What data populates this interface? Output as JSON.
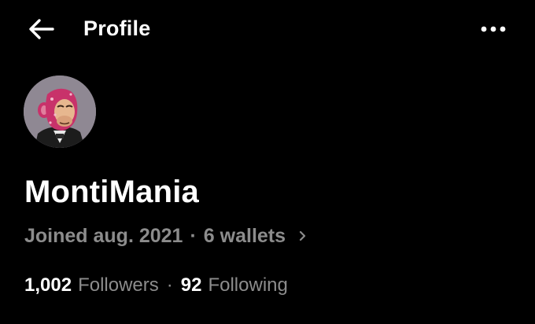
{
  "header": {
    "back_icon": "arrow-left-icon",
    "title": "Profile",
    "more_icon": "more-horizontal-icon"
  },
  "profile": {
    "avatar": "ape-nft-avatar",
    "name": "MontiMania",
    "joined": "Joined aug. 2021",
    "separator": "·",
    "wallets": "6 wallets",
    "wallets_icon": "chevron-right-icon"
  },
  "stats": {
    "followers_count": "1,002",
    "followers_label": "Followers",
    "separator": "·",
    "following_count": "92",
    "following_label": "Following"
  },
  "colors": {
    "background": "#000000",
    "text_primary": "#ffffff",
    "text_secondary": "#8c8c8c",
    "avatar_bg": "#8f8893",
    "avatar_fur": "#c8326a"
  }
}
